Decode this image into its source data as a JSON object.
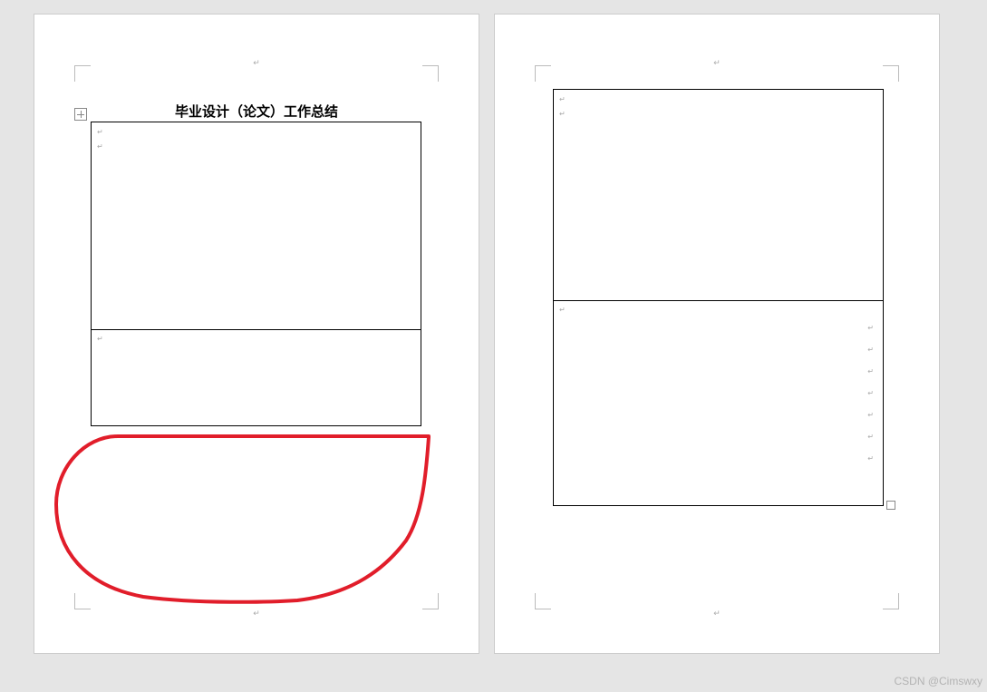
{
  "pages": {
    "left": {
      "header_paragraph_mark": "↵",
      "title": "毕业设计（论文）工作总结",
      "table": {
        "cell_marks": [
          "↵",
          "↵",
          "↵"
        ]
      },
      "footer_paragraph_mark": "↵"
    },
    "right": {
      "header_paragraph_mark": "↵",
      "table": {
        "cell_marks": [
          "↵",
          "↵",
          "↵",
          "↵",
          "↵",
          "↵",
          "↵",
          "↵",
          "↵",
          "↵"
        ]
      },
      "footer_paragraph_mark": "↵"
    }
  },
  "annotation": {
    "color": "#e11d2a",
    "stroke_width": 4
  },
  "watermark": "CSDN @Cimswxy"
}
